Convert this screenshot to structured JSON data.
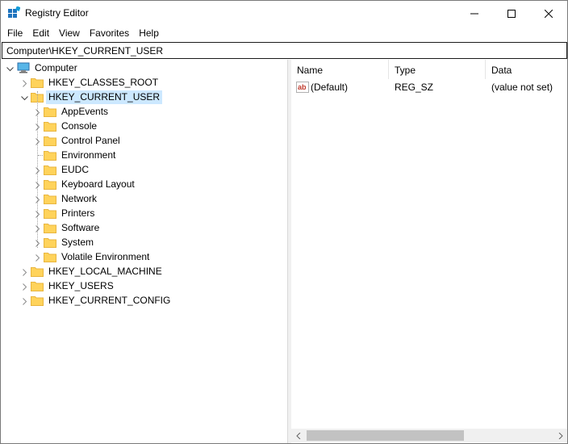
{
  "window": {
    "title": "Registry Editor"
  },
  "menu": {
    "file": "File",
    "edit": "Edit",
    "view": "View",
    "favorites": "Favorites",
    "help": "Help"
  },
  "address": {
    "path": "Computer\\HKEY_CURRENT_USER"
  },
  "tree": {
    "root": "Computer",
    "hives": [
      "HKEY_CLASSES_ROOT",
      "HKEY_CURRENT_USER",
      "HKEY_LOCAL_MACHINE",
      "HKEY_USERS",
      "HKEY_CURRENT_CONFIG"
    ],
    "hkcu_children": [
      "AppEvents",
      "Console",
      "Control Panel",
      "Environment",
      "EUDC",
      "Keyboard Layout",
      "Network",
      "Printers",
      "Software",
      "System",
      "Volatile Environment"
    ],
    "selected": "HKEY_CURRENT_USER"
  },
  "list": {
    "columns": [
      "Name",
      "Type",
      "Data"
    ],
    "rows": [
      {
        "name": "(Default)",
        "type": "REG_SZ",
        "data": "(value not set)"
      }
    ]
  },
  "colors": {
    "selection": "#cce8ff",
    "folder": "#ffd35b",
    "folder_tab": "#e8b53f",
    "border": "#1a1a1a"
  }
}
